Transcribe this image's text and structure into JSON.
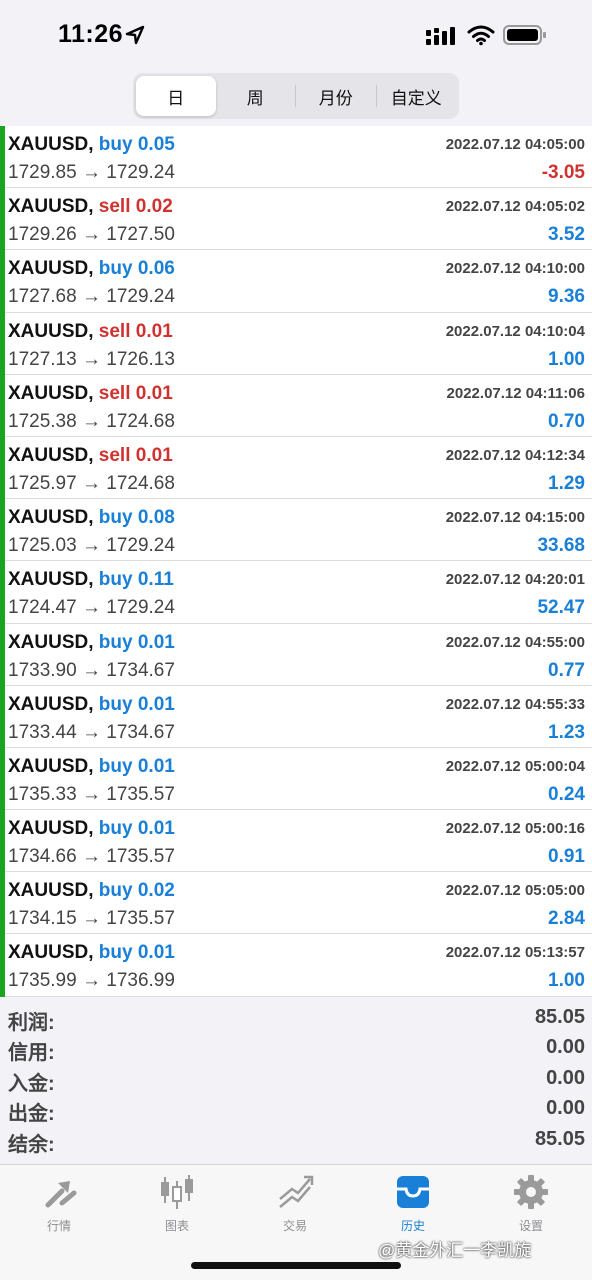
{
  "status_bar": {
    "time": "11:26"
  },
  "period_tabs": [
    {
      "label": "日",
      "active": true
    },
    {
      "label": "周",
      "active": false
    },
    {
      "label": "月份",
      "active": false
    },
    {
      "label": "自定义",
      "active": false
    }
  ],
  "colors": {
    "buy": "#1a7fd6",
    "sell": "#d0322f",
    "accent_bar": "#1aa520",
    "active_tab": "#1a7fd6"
  },
  "arrow": "→",
  "trades": [
    {
      "symbol": "XAUUSD,",
      "side": "buy",
      "volume": "0.05",
      "time": "2022.07.12 04:05:00",
      "open": "1729.85",
      "close": "1729.24",
      "profit": "-3.05"
    },
    {
      "symbol": "XAUUSD,",
      "side": "sell",
      "volume": "0.02",
      "time": "2022.07.12 04:05:02",
      "open": "1729.26",
      "close": "1727.50",
      "profit": "3.52"
    },
    {
      "symbol": "XAUUSD,",
      "side": "buy",
      "volume": "0.06",
      "time": "2022.07.12 04:10:00",
      "open": "1727.68",
      "close": "1729.24",
      "profit": "9.36"
    },
    {
      "symbol": "XAUUSD,",
      "side": "sell",
      "volume": "0.01",
      "time": "2022.07.12 04:10:04",
      "open": "1727.13",
      "close": "1726.13",
      "profit": "1.00"
    },
    {
      "symbol": "XAUUSD,",
      "side": "sell",
      "volume": "0.01",
      "time": "2022.07.12 04:11:06",
      "open": "1725.38",
      "close": "1724.68",
      "profit": "0.70"
    },
    {
      "symbol": "XAUUSD,",
      "side": "sell",
      "volume": "0.01",
      "time": "2022.07.12 04:12:34",
      "open": "1725.97",
      "close": "1724.68",
      "profit": "1.29"
    },
    {
      "symbol": "XAUUSD,",
      "side": "buy",
      "volume": "0.08",
      "time": "2022.07.12 04:15:00",
      "open": "1725.03",
      "close": "1729.24",
      "profit": "33.68"
    },
    {
      "symbol": "XAUUSD,",
      "side": "buy",
      "volume": "0.11",
      "time": "2022.07.12 04:20:01",
      "open": "1724.47",
      "close": "1729.24",
      "profit": "52.47"
    },
    {
      "symbol": "XAUUSD,",
      "side": "buy",
      "volume": "0.01",
      "time": "2022.07.12 04:55:00",
      "open": "1733.90",
      "close": "1734.67",
      "profit": "0.77"
    },
    {
      "symbol": "XAUUSD,",
      "side": "buy",
      "volume": "0.01",
      "time": "2022.07.12 04:55:33",
      "open": "1733.44",
      "close": "1734.67",
      "profit": "1.23"
    },
    {
      "symbol": "XAUUSD,",
      "side": "buy",
      "volume": "0.01",
      "time": "2022.07.12 05:00:04",
      "open": "1735.33",
      "close": "1735.57",
      "profit": "0.24"
    },
    {
      "symbol": "XAUUSD,",
      "side": "buy",
      "volume": "0.01",
      "time": "2022.07.12 05:00:16",
      "open": "1734.66",
      "close": "1735.57",
      "profit": "0.91"
    },
    {
      "symbol": "XAUUSD,",
      "side": "buy",
      "volume": "0.02",
      "time": "2022.07.12 05:05:00",
      "open": "1734.15",
      "close": "1735.57",
      "profit": "2.84"
    },
    {
      "symbol": "XAUUSD,",
      "side": "buy",
      "volume": "0.01",
      "time": "2022.07.12 05:13:57",
      "open": "1735.99",
      "close": "1736.99",
      "profit": "1.00"
    }
  ],
  "summary": [
    {
      "label": "利润:",
      "value": "85.05"
    },
    {
      "label": "信用:",
      "value": "0.00"
    },
    {
      "label": "入金:",
      "value": "0.00"
    },
    {
      "label": "出金:",
      "value": "0.00"
    },
    {
      "label": "结余:",
      "value": "85.05"
    }
  ],
  "tabbar": [
    {
      "label": "行情",
      "icon": "quotes-icon",
      "active": false
    },
    {
      "label": "图表",
      "icon": "chart-icon",
      "active": false
    },
    {
      "label": "交易",
      "icon": "trade-icon",
      "active": false
    },
    {
      "label": "历史",
      "icon": "history-icon",
      "active": true
    },
    {
      "label": "设置",
      "icon": "settings-icon",
      "active": false
    }
  ],
  "watermark": "@黄金外汇一李凯旋"
}
